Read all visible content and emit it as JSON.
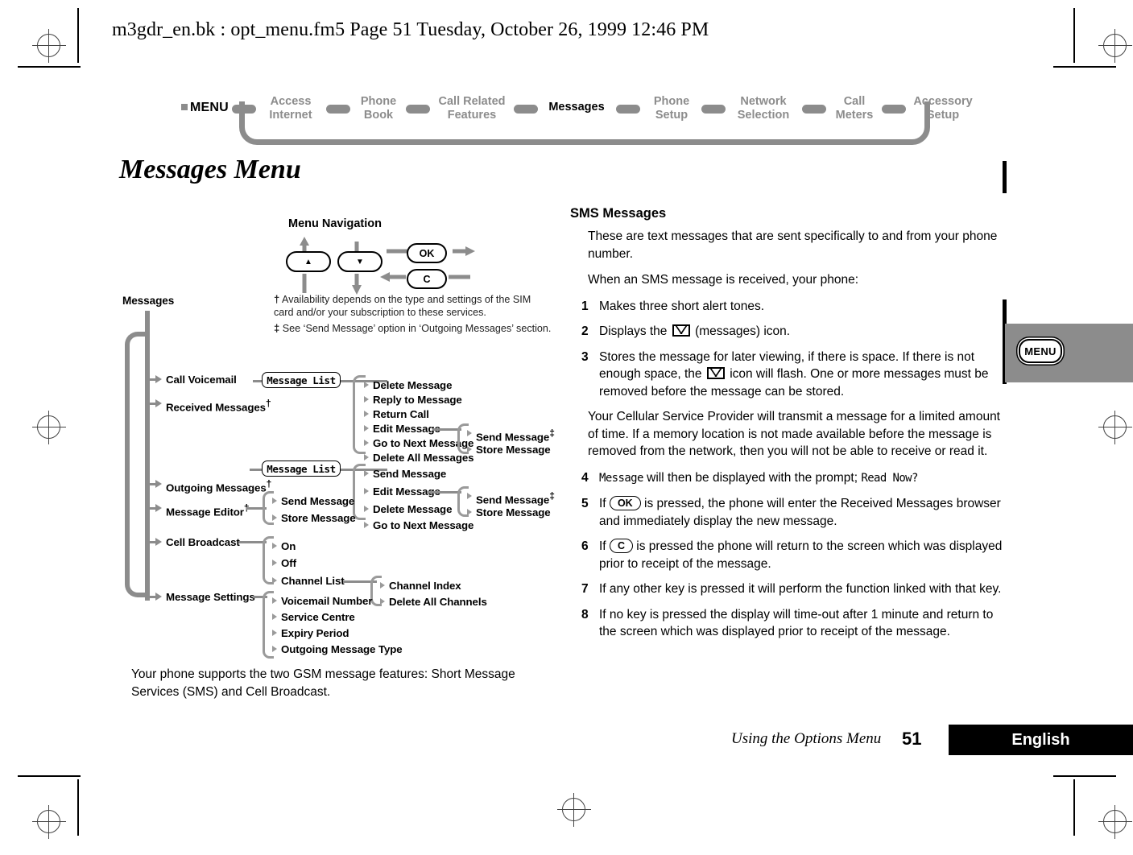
{
  "page_header": "m3gdr_en.bk : opt_menu.fm5  Page 51  Tuesday, October 26, 1999  12:46 PM",
  "breadcrumb": {
    "menu_label": "MENU",
    "items": [
      {
        "label": "Access\nInternet",
        "active": false
      },
      {
        "label": "Phone\nBook",
        "active": false
      },
      {
        "label": "Call Related\nFeatures",
        "active": false
      },
      {
        "label": "Messages",
        "active": true
      },
      {
        "label": "Phone\nSetup",
        "active": false
      },
      {
        "label": "Network\nSelection",
        "active": false
      },
      {
        "label": "Call\nMeters",
        "active": false
      },
      {
        "label": "Accessory\nSetup",
        "active": false
      }
    ]
  },
  "title": "Messages Menu",
  "side_tab": {
    "menu_key_label": "MENU"
  },
  "nav_legend": {
    "title": "Menu Navigation",
    "key_up": "▲",
    "key_down": "▼",
    "key_ok": "OK",
    "key_clear": "C",
    "footnote_dagger_mark": "†",
    "footnote_dagger": "Availability depends on the type and settings of the SIM card and/or your subscription to these services.",
    "footnote_doubledagger_mark": "‡",
    "footnote_doubledagger": "See ‘Send Message’ option in ‘Outgoing Messages’ section."
  },
  "tree": {
    "root": "Messages",
    "level1": [
      {
        "label": "Call Voicemail",
        "dagger": ""
      },
      {
        "label": "Received Messages",
        "dagger": "†"
      },
      {
        "label": "Outgoing Messages",
        "dagger": "†"
      },
      {
        "label": "Message Editor",
        "dagger": "†"
      },
      {
        "label": "Cell Broadcast",
        "dagger": ""
      },
      {
        "label": "Message Settings",
        "dagger": ""
      }
    ],
    "lcd_received": "Message List",
    "lcd_outgoing": "Message List",
    "received_options": [
      "Delete Message",
      "Reply to Message",
      "Return Call",
      "Edit Message",
      "Go to Next Message",
      "Delete All Messages"
    ],
    "outgoing_options": [
      "Send Message",
      "Edit Message",
      "Delete Message",
      "Go to Next Message"
    ],
    "edit_sub_received": [
      {
        "label": "Send Message",
        "dagger": "‡"
      },
      {
        "label": "Store Message",
        "dagger": ""
      }
    ],
    "edit_sub_outgoing": [
      {
        "label": "Send Message",
        "dagger": "‡"
      },
      {
        "label": "Store Message",
        "dagger": ""
      }
    ],
    "message_editor_options": [
      "Send Message",
      "Store Message"
    ],
    "cell_broadcast_options": [
      "On",
      "Off",
      "Channel List"
    ],
    "channel_list_options": [
      "Channel Index",
      "Delete All Channels"
    ],
    "message_settings_options": [
      "Voicemail Number",
      "Service Centre",
      "Expiry Period",
      "Outgoing Message Type"
    ]
  },
  "caption": "Your phone supports the two GSM message features: Short Message Services (SMS) and Cell Broadcast.",
  "sms": {
    "heading": "SMS Messages",
    "intro1": "These are text messages that are sent specifically to and from your phone number.",
    "intro2": "When an SMS message is received, your phone:",
    "step1_num": "1",
    "step1": "Makes three short alert tones.",
    "step2_num": "2",
    "step2_a": "Displays the",
    "step2_b": "(messages) icon.",
    "step3_num": "3",
    "step3_a": "Stores the message for later viewing, if there is space. If there is not enough space, the",
    "step3_b": "icon will flash. One or more messages must be removed before the message can be stored.",
    "para_provider": "Your Cellular Service Provider will transmit a message for a limited amount of time. If a memory location is not made available before the message is removed from the network, then you will not be able to receive or read it.",
    "step4_num": "4",
    "step4_lcd1": "Message",
    "step4_mid": "will then be displayed with the prompt;",
    "step4_lcd2": "Read Now?",
    "step5_num": "5",
    "step5_a": "If",
    "step5_key": "OK",
    "step5_b": "is pressed, the phone will enter the Received Messages browser and immediately display the new message.",
    "step6_num": "6",
    "step6_a": "If",
    "step6_key": "C",
    "step6_b": "is pressed the phone will return to the screen which was displayed prior to receipt of the message.",
    "step7_num": "7",
    "step7": "If any other key is pressed it will perform the function linked with that key.",
    "step8_num": "8",
    "step8": "If no key is pressed the display will time-out after 1 minute and return to the screen which was displayed prior to receipt of the message."
  },
  "footer": {
    "running_head": "Using the Options Menu",
    "page_number": "51",
    "language": "English"
  }
}
